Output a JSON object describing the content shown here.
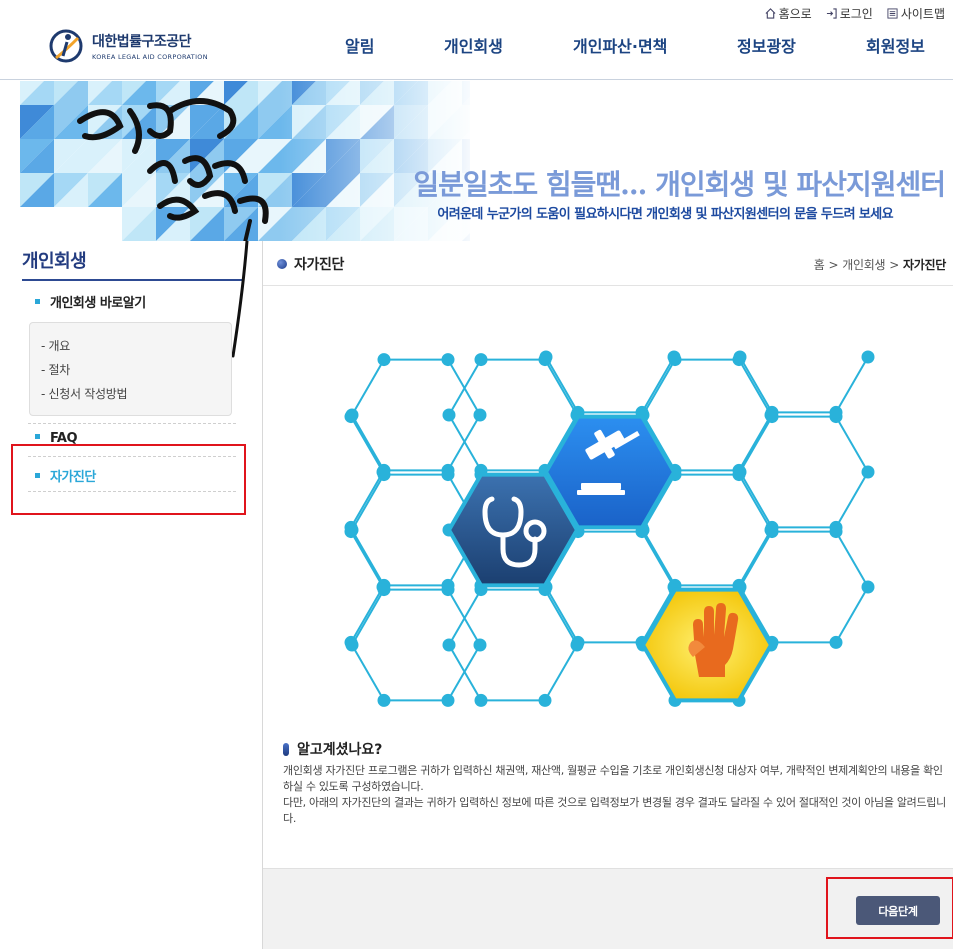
{
  "header": {
    "logo_ko": "대한법률구조공단",
    "logo_en": "KOREA LEGAL AID CORPORATION",
    "util": {
      "home": "홈으로",
      "login": "로그인",
      "sitemap": "사이트맵"
    },
    "nav": [
      "알림",
      "개인회생",
      "개인파산·면책",
      "정보광장",
      "회원정보"
    ]
  },
  "banner": {
    "title": "일분일초도 힘들땐... 개인회생 및 파산지원센터",
    "subtitle": "어려운데 누군가의 도움이 필요하시다면 개인회생 및 파산지원센터의 문을 두드려 보세요"
  },
  "sidebar": {
    "title": "개인회생",
    "menu_main": "개인회생 바로알기",
    "sub_items": [
      "- 개요",
      "- 절차",
      "- 신청서 작성방법"
    ],
    "faq": "FAQ",
    "self_check": "자가진단"
  },
  "content": {
    "page_title": "자가진단",
    "breadcrumb": [
      "홈",
      "개인회생",
      "자가진단"
    ],
    "info_title": "알고계셨나요?",
    "info_p1": "개인회생 자가진단 프로그램은 귀하가 입력하신 채권액, 재산액, 월평균 수입을 기초로 개인회생신청 대상자 여부, 개략적인 변제계획안의 내용을 확인하실 수 있도록 구성하였습니다.",
    "info_p2": "다만, 아래의 자가진단의 결과는 귀하가 입력하신 정보에 따른 것으로 입력정보가 변경될 경우 결과도 달라질 수 있어 절대적인 것이 아님을 알려드립니다.",
    "next_button": "다음단계"
  },
  "icons": [
    "home-icon",
    "login-icon",
    "sitemap-icon",
    "stethoscope-icon",
    "gavel-icon",
    "hand-icon"
  ],
  "colors": {
    "accent": "#2aa7d8",
    "nav": "#1c4482",
    "highlight": "#e0141c",
    "button": "#4b5878"
  }
}
